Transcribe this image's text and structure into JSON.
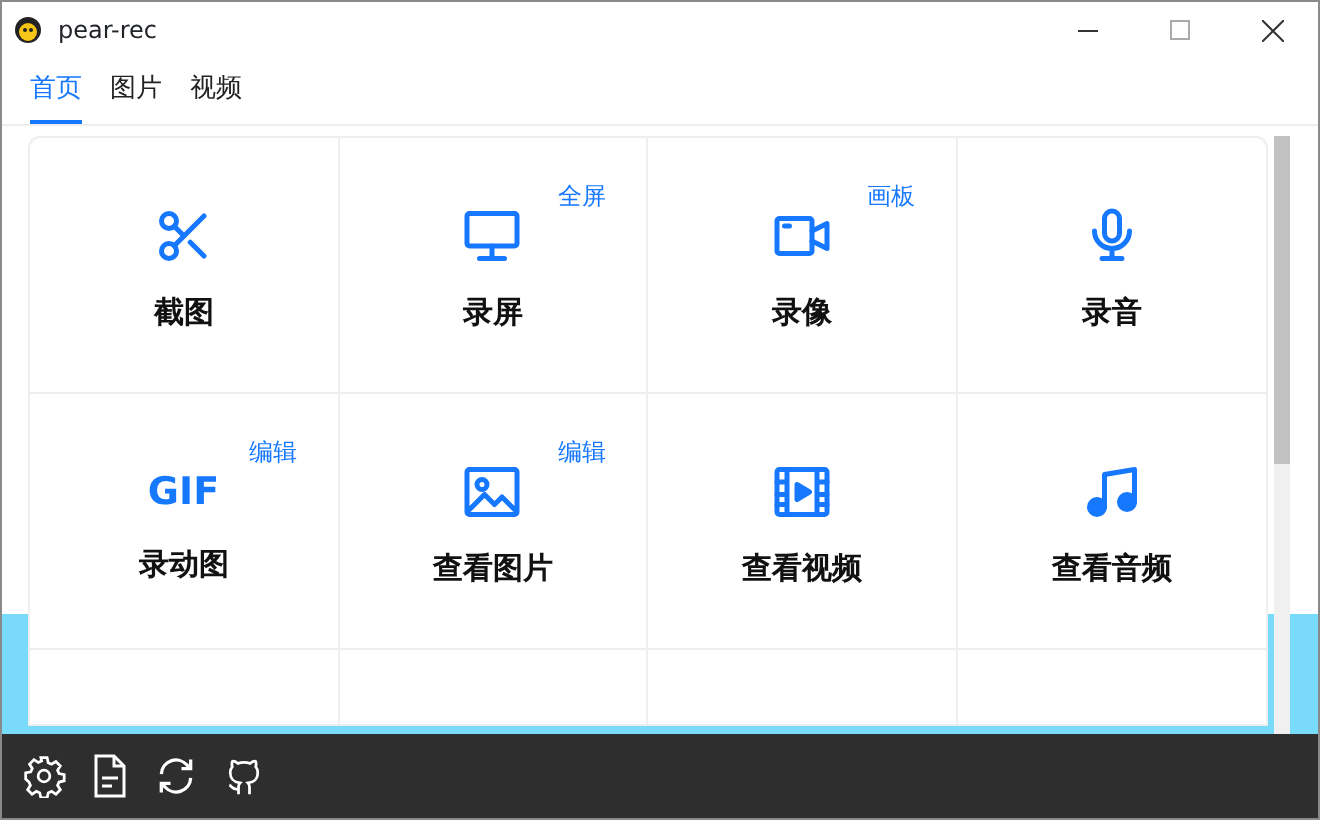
{
  "window": {
    "title": "pear-rec"
  },
  "tabs": [
    {
      "label": "首页",
      "selected": true
    },
    {
      "label": "图片",
      "selected": false
    },
    {
      "label": "视频",
      "selected": false
    }
  ],
  "tiles": [
    {
      "kind": "scissors",
      "label": "截图"
    },
    {
      "kind": "monitor",
      "label": "录屏",
      "tag": "全屏"
    },
    {
      "kind": "camera",
      "label": "录像",
      "tag": "画板"
    },
    {
      "kind": "mic",
      "label": "录音"
    },
    {
      "kind": "gif",
      "icon_text": "GIF",
      "label": "录动图",
      "tag": "编辑"
    },
    {
      "kind": "image",
      "label": "查看图片",
      "tag": "编辑"
    },
    {
      "kind": "film",
      "label": "查看视频"
    },
    {
      "kind": "music",
      "label": "查看音频"
    }
  ]
}
